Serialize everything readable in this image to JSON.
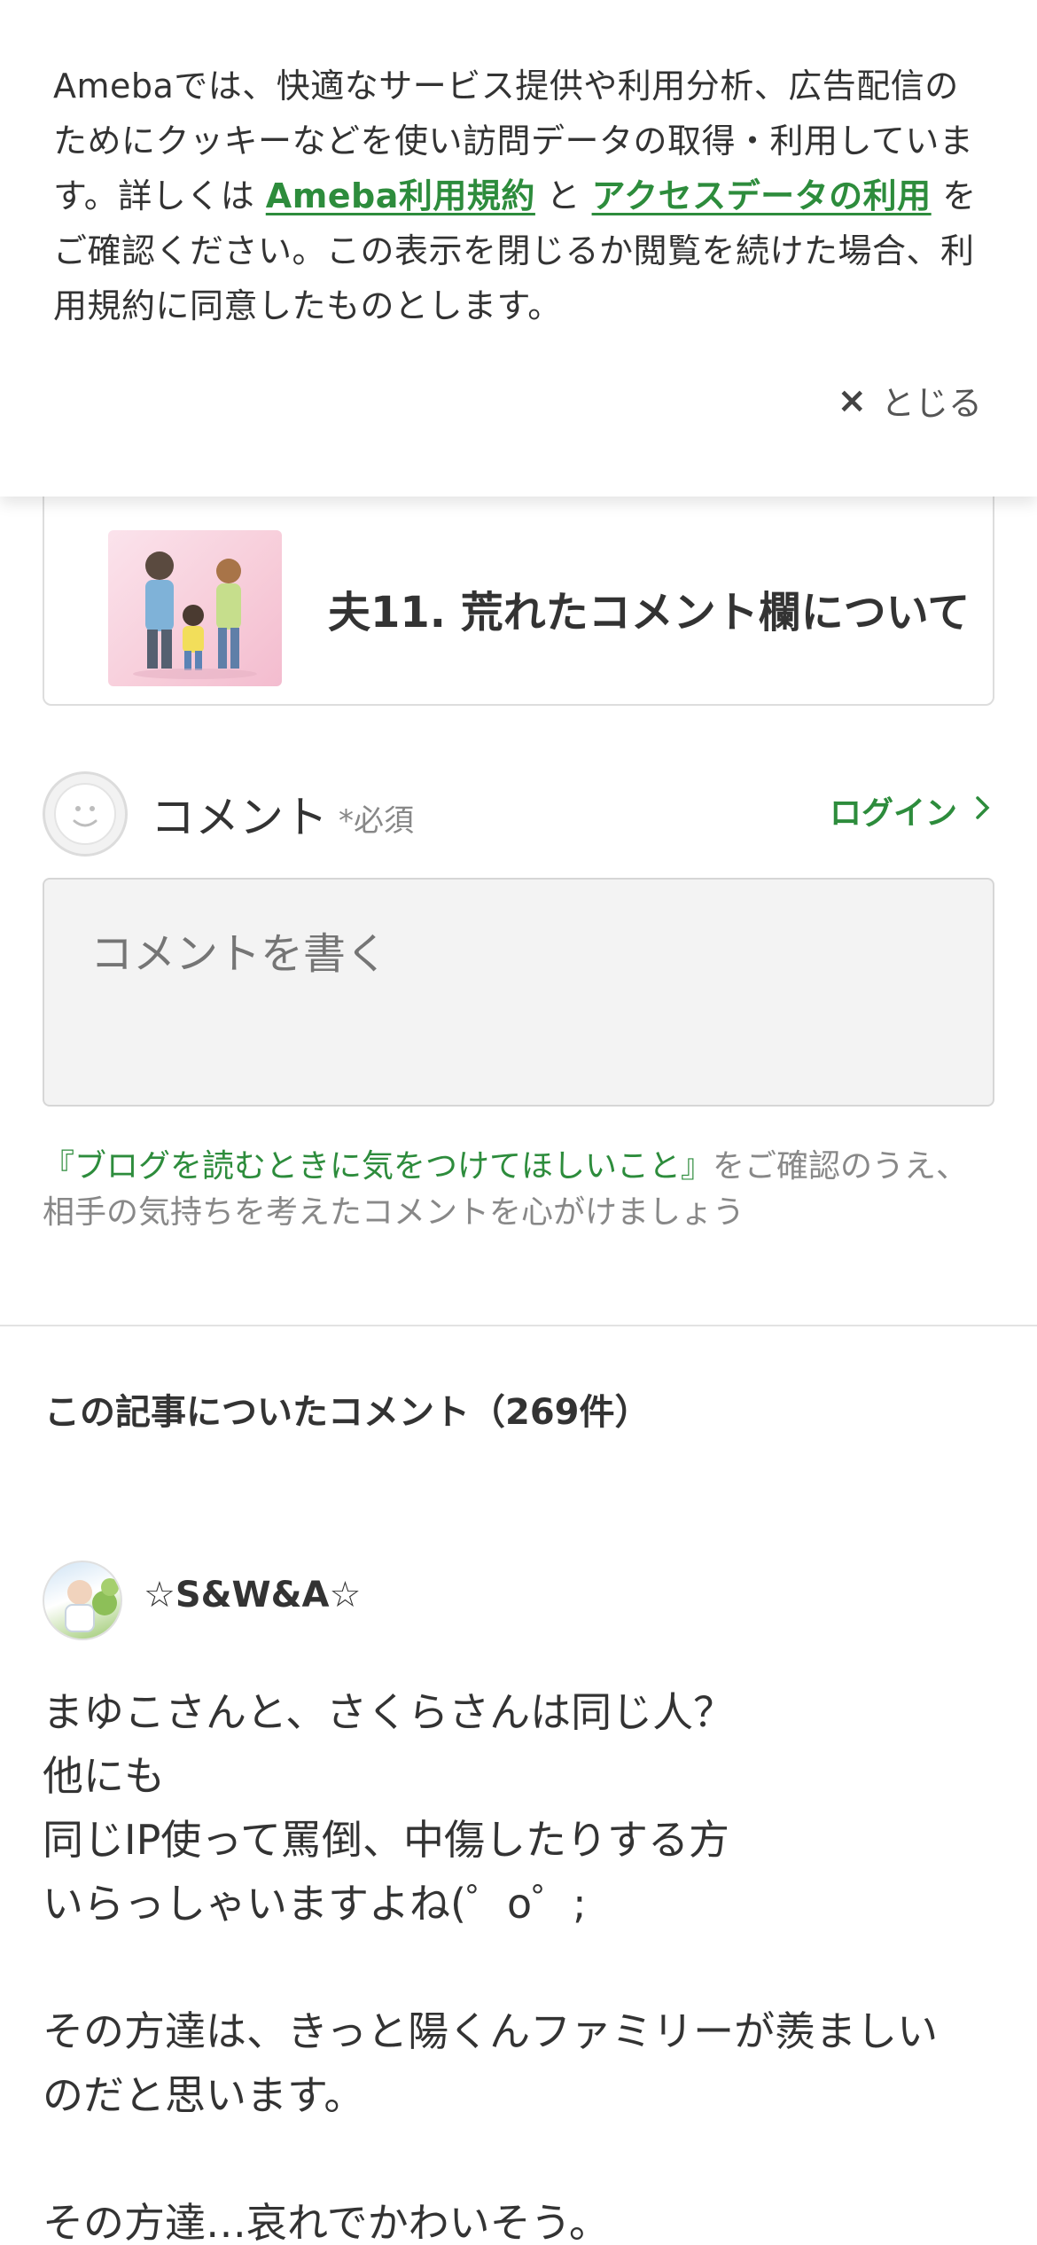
{
  "cookie_banner": {
    "text_part1": "Amebaでは、快適なサービス提供や利用分析、広告配信のためにクッキーなどを使い訪問データの取得・利用しています。詳しくは ",
    "link1": "Ameba利用規約",
    "text_part2": " と ",
    "link2": "アクセスデータの利用",
    "text_part3": " をご確認ください。この表示を閉じるか閲覧を続けた場合、利用規約に同意したものとします。",
    "close_icon": "×",
    "close_label": "とじる"
  },
  "article_card": {
    "thumbnail_icon": "family-illustration",
    "title": "夫11. 荒れたコメント欄について"
  },
  "comment_form": {
    "avatar_icon": "default-user-icon",
    "label": "コメント",
    "required": "*必須",
    "login_label": "ログイン",
    "login_icon": "chevron-right-icon",
    "placeholder": "コメントを書く",
    "notice_link": "『ブログを読むときに気をつけてほしいこと』",
    "notice_text": "をご確認のうえ、相手の気持ちを考えたコメントを心がけましょう"
  },
  "comments_section": {
    "heading": "この記事についたコメント（269件）",
    "comments": [
      {
        "author": "☆S&W&A☆",
        "lines": [
          "まゆこさんと、さくらさんは同じ人？",
          "他にも",
          "同じIP使って罵倒、中傷したりする方",
          "いらっしゃいますよね(゜o゜;",
          "",
          "その方達は、きっと陽くんファミリーが羨ましい",
          "のだと思います。",
          "",
          "その方達…哀れでかわいそう。"
        ]
      }
    ]
  },
  "colors": {
    "accent_green": "#2d8c3c",
    "text": "#333333",
    "muted": "#888888"
  }
}
